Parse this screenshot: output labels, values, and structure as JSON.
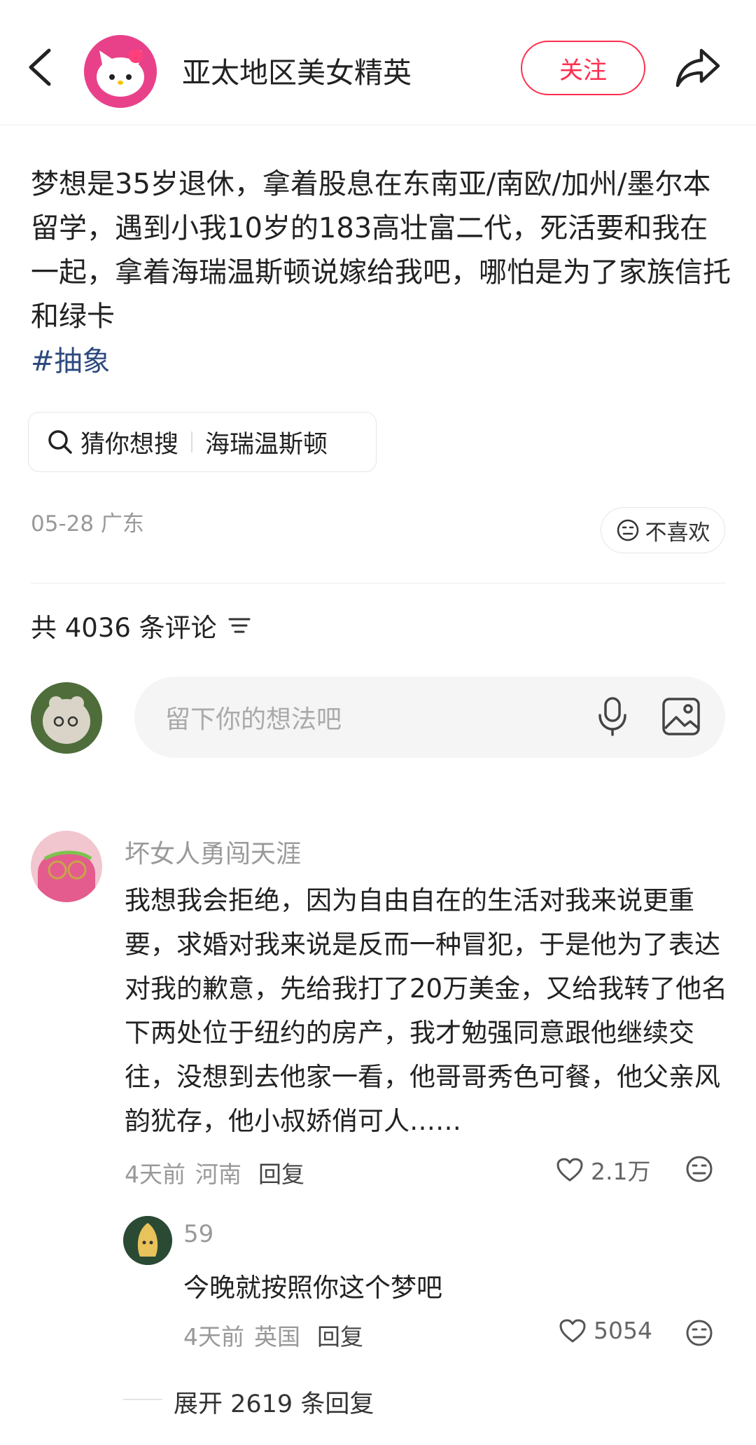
{
  "header": {
    "author_name": "亚太地区美女精英",
    "follow_label": "关注"
  },
  "post": {
    "body": "梦想是35岁退休，拿着股息在东南亚/南欧/加州/墨尔本留学，遇到小我10岁的183高壮富二代，死活要和我在一起，拿着海瑞温斯顿说嫁给我吧，哪怕是为了家族信托和绿卡",
    "hashtag": "#抽象",
    "search_chip": {
      "label": "猜你想搜",
      "term": "海瑞温斯顿"
    },
    "date_location": "05-28 广东",
    "dislike_label": "不喜欢"
  },
  "comments_header": {
    "count_label": "共 4036 条评论"
  },
  "comment_input": {
    "placeholder": "留下你的想法吧"
  },
  "comment": {
    "author": "坏女人勇闯天涯",
    "text": "我想我会拒绝，因为自由自在的生活对我来说更重要，求婚对我来说是反而一种冒犯，于是他为了表达对我的歉意，先给我打了20万美金，又给我转了他名下两处位于纽约的房产，我才勉强同意跟他继续交往，没想到去他家一看，他哥哥秀色可餐，他父亲风韵犹存，他小叔娇俏可人……",
    "time": "4天前",
    "location": "河南",
    "reply_label": "回复",
    "likes": "2.1万"
  },
  "reply": {
    "author": "59",
    "text": "今晚就按照你这个梦吧",
    "time": "4天前",
    "location": "英国",
    "reply_label": "回复",
    "likes": "5054"
  },
  "expand_label": "展开 2619 条回复",
  "colors": {
    "accent": "#ff2e4d",
    "hashtag": "#2d4a7e",
    "muted": "#999999"
  }
}
